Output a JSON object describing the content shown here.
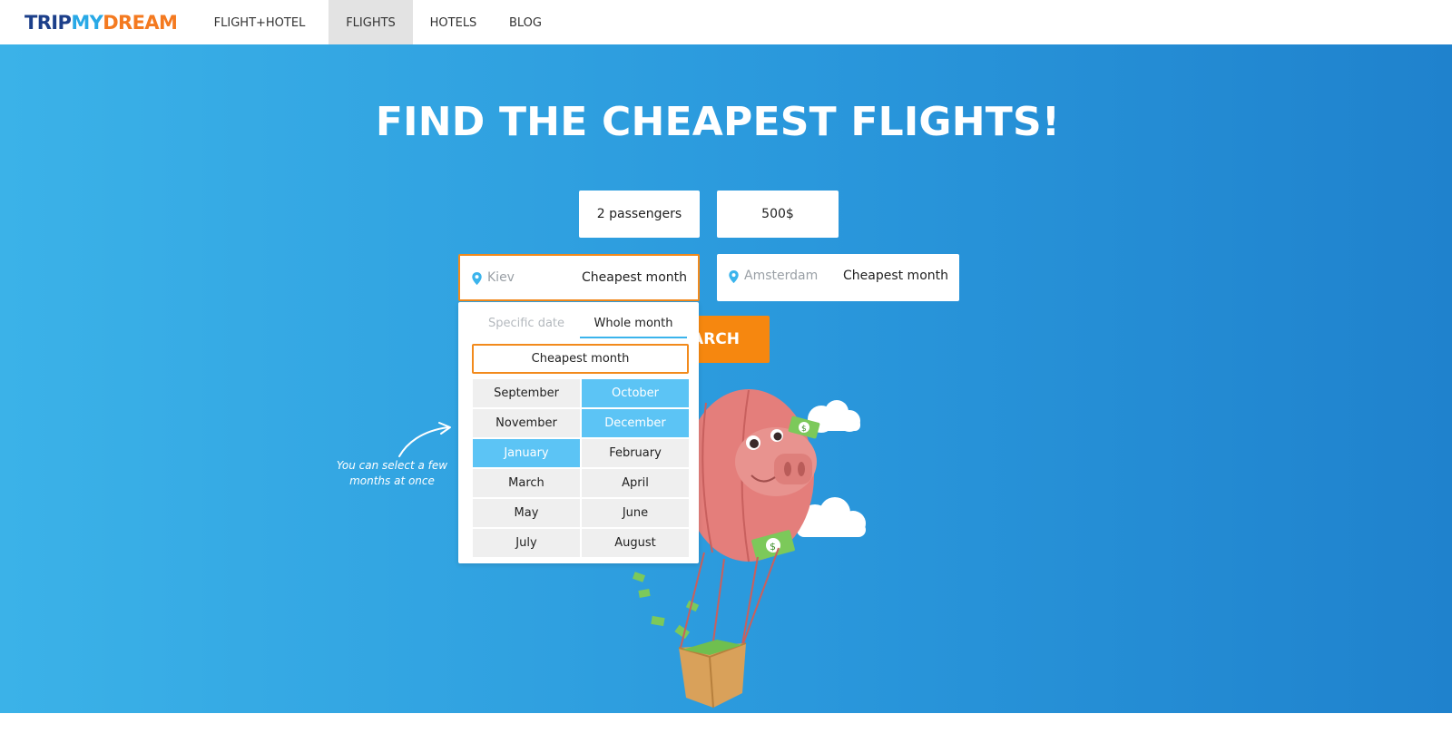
{
  "brand": {
    "part1": "TRIP",
    "part2": "MY",
    "part3": "DREAM"
  },
  "nav": {
    "items": [
      {
        "label": "FLIGHT+HOTEL",
        "active": false
      },
      {
        "label": "FLIGHTS",
        "active": true
      },
      {
        "label": "HOTELS",
        "active": false
      },
      {
        "label": "BLOG",
        "active": false
      }
    ]
  },
  "hero": {
    "headline": "FIND THE CHEAPEST FLIGHTS!"
  },
  "search": {
    "passengers": "2 passengers",
    "budget": "500$",
    "origin": {
      "city": "Kiev",
      "when": "Cheapest month"
    },
    "destination": {
      "city": "Amsterdam",
      "when": "Cheapest month"
    },
    "button_label": "SEARCH"
  },
  "dropdown": {
    "tabs": [
      "Specific date",
      "Whole month"
    ],
    "active_tab": "Whole month",
    "cheapest_option": "Cheapest month",
    "months": [
      {
        "label": "September",
        "selected": false
      },
      {
        "label": "October",
        "selected": true
      },
      {
        "label": "November",
        "selected": false
      },
      {
        "label": "December",
        "selected": true
      },
      {
        "label": "January",
        "selected": true
      },
      {
        "label": "February",
        "selected": false
      },
      {
        "label": "March",
        "selected": false
      },
      {
        "label": "April",
        "selected": false
      },
      {
        "label": "May",
        "selected": false
      },
      {
        "label": "June",
        "selected": false
      },
      {
        "label": "July",
        "selected": false
      },
      {
        "label": "August",
        "selected": false
      }
    ]
  },
  "hint": {
    "text": "You can select a few months at once"
  },
  "colors": {
    "accent_orange": "#f6870f",
    "selected_blue": "#5cc4f5",
    "hero_blue": "#2a98dc",
    "logo_navy": "#1c3f8a"
  },
  "icons": [
    "location-pin-icon",
    "curved-arrow-icon",
    "piggy-bank-balloon-illustration"
  ]
}
